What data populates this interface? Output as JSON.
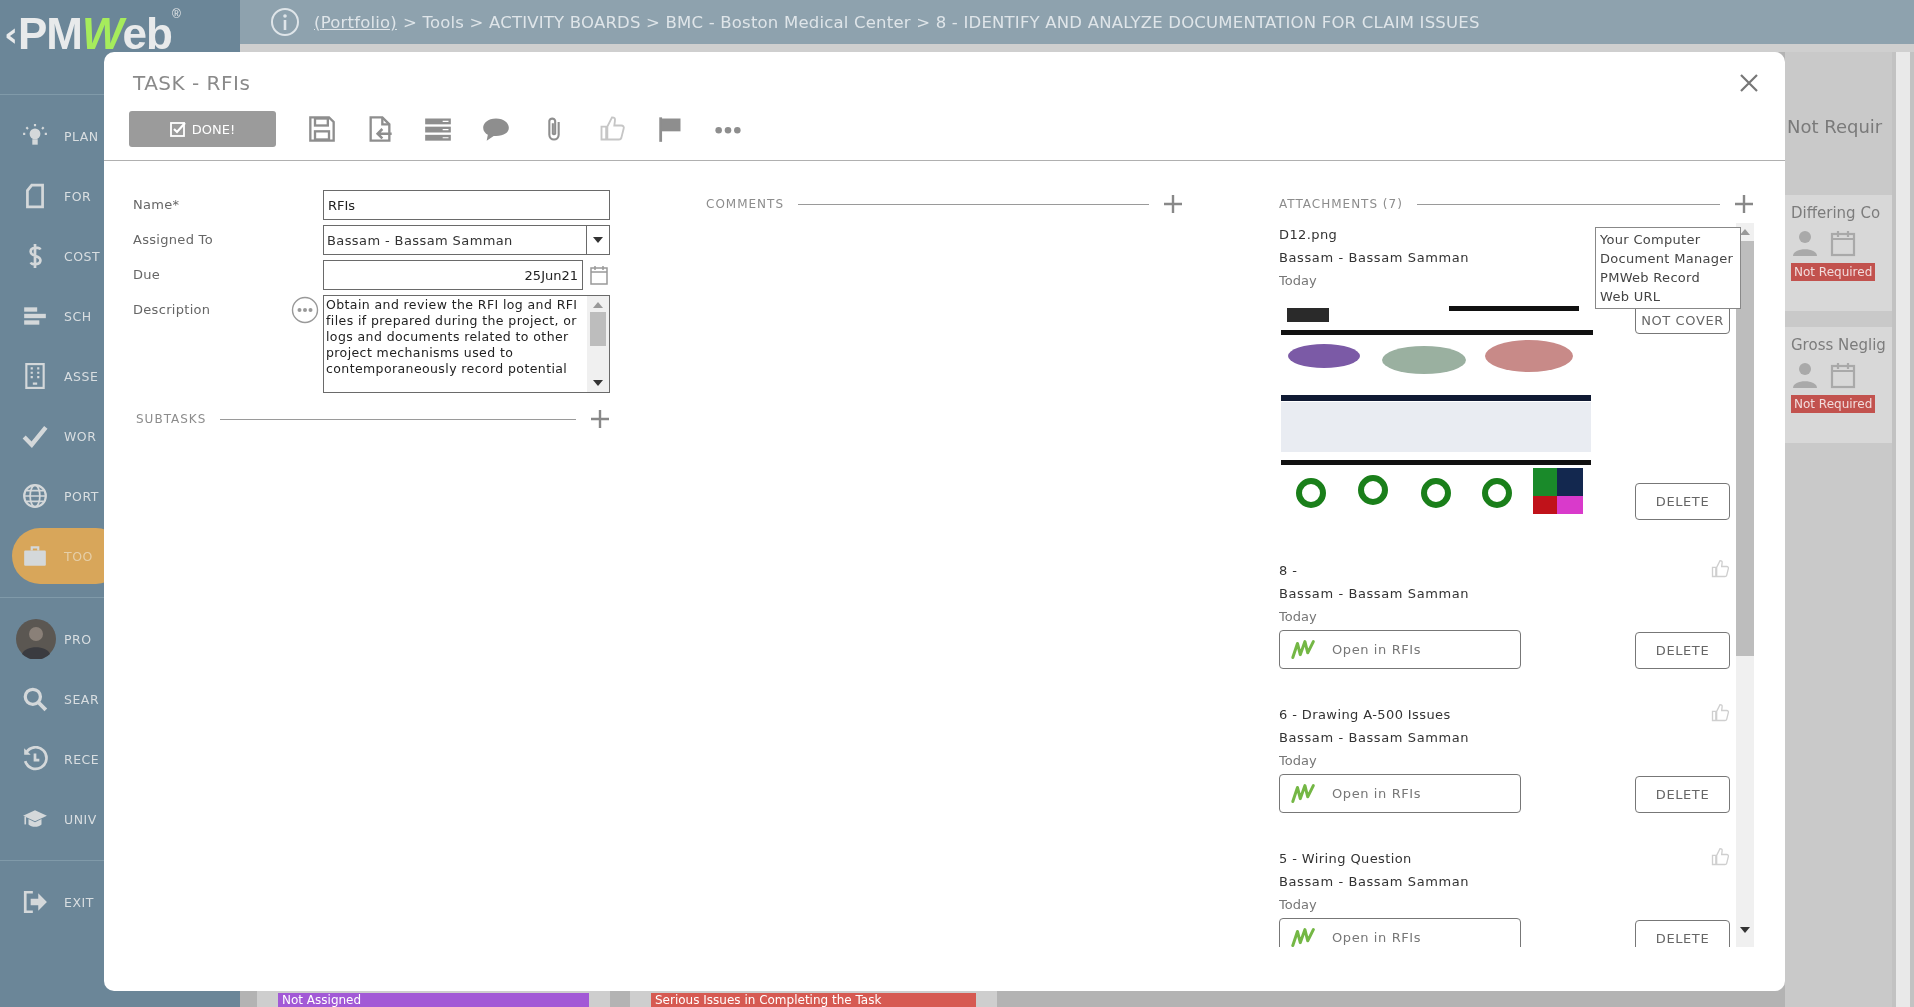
{
  "logo": {
    "back": "‹",
    "name_start": "PM",
    "name_accent": "W",
    "name_end": "eb",
    "mark": "®"
  },
  "breadcrumb": {
    "link": "(Portfolio)",
    "path": "> Tools > ACTIVITY BOARDS > BMC - Boston Medical Center > 8 - IDENTIFY AND ANALYZE DOCUMENTATION FOR CLAIM ISSUES"
  },
  "sidebar": {
    "groups": [
      [
        {
          "kind": "bulb",
          "label": "PLAN",
          "selected": false
        },
        {
          "kind": "form",
          "label": "FOR",
          "selected": false
        },
        {
          "kind": "dollar",
          "label": "COST",
          "selected": false
        },
        {
          "kind": "schedule",
          "label": "SCH",
          "selected": false
        },
        {
          "kind": "building",
          "label": "ASSE",
          "selected": false
        },
        {
          "kind": "check",
          "label": "WOR",
          "selected": false
        },
        {
          "kind": "globe",
          "label": "PORT",
          "selected": false
        },
        {
          "kind": "briefcase",
          "label": "TOO",
          "selected": true
        }
      ],
      [
        {
          "kind": "avatar",
          "label": "PRO",
          "selected": false
        },
        {
          "kind": "search",
          "label": "SEAR",
          "selected": false
        },
        {
          "kind": "recent",
          "label": "RECE",
          "selected": false
        },
        {
          "kind": "cap",
          "label": "UNIV",
          "selected": false
        }
      ],
      [
        {
          "kind": "exit",
          "label": "EXIT",
          "selected": false
        }
      ]
    ]
  },
  "board": {
    "column_title": "Not Requir",
    "cards": [
      {
        "title": "Differing Co",
        "tag": "Not Required"
      },
      {
        "title": "Gross Neglig",
        "tag": "Not Required"
      }
    ],
    "bottom_tags": [
      {
        "label": "Not Assigned",
        "color": "#a259d6"
      },
      {
        "label": "Serious Issues in Completing the Task",
        "color": "#d65a52"
      }
    ]
  },
  "dialog": {
    "title": "TASK - RFIs",
    "done": "DONE!",
    "fields": [
      {
        "kind": "text",
        "label": "Name*",
        "value": "RFIs"
      },
      {
        "kind": "select",
        "label": "Assigned To",
        "value": "Bassam - Bassam Samman"
      },
      {
        "kind": "date",
        "label": "Due",
        "value": "25Jun21"
      },
      {
        "kind": "textarea",
        "label": "Description",
        "value": "Obtain and review the RFI log and RFI files if prepared during the project, or logs and documents related to other project mechanisms used to contemporaneously record potential"
      }
    ],
    "subtasks": "SUBTASKS",
    "comments": "COMMENTS",
    "attachments": {
      "title": "ATTACHMENTS (7)",
      "menu": [
        "Your Computer",
        "Document Manager",
        "PMWeb Record",
        "Web URL"
      ],
      "items": [
        {
          "name": "D12.png",
          "user": "Bassam - Bassam Samman",
          "date": "Today",
          "action": "NOT COVER",
          "delete": "DELETE"
        },
        {
          "kind": "record",
          "name": "8 -",
          "user": "Bassam - Bassam Samman",
          "date": "Today",
          "link": "Open in RFIs",
          "delete": "DELETE"
        },
        {
          "kind": "record",
          "name": "6 - Drawing A-500 Issues",
          "user": "Bassam - Bassam Samman",
          "date": "Today",
          "link": "Open in RFIs",
          "delete": "DELETE"
        },
        {
          "kind": "record",
          "name": "5 - Wiring Question",
          "user": "Bassam - Bassam Samman",
          "date": "Today",
          "link": "Open in RFIs",
          "delete": "DELETE"
        }
      ]
    }
  }
}
